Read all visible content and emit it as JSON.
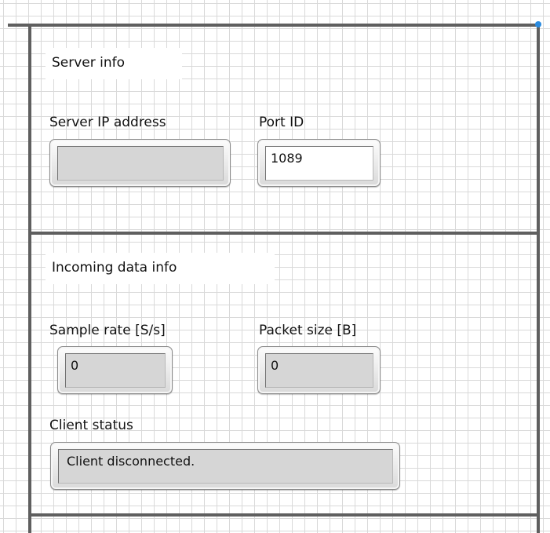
{
  "server_info": {
    "header": "Server info",
    "ip_label": "Server IP address",
    "ip_value": "",
    "port_label": "Port ID",
    "port_value": "1089"
  },
  "incoming_data_info": {
    "header": "Incoming data info",
    "sample_rate_label": "Sample rate [S/s]",
    "sample_rate_value": "0",
    "packet_size_label": "Packet size [B]",
    "packet_size_value": "0"
  },
  "client_status": {
    "label": "Client status",
    "value": "Client disconnected."
  },
  "colors": {
    "accent_dot": "#2a8be0",
    "frame": "#5f5f5f",
    "indicator_fill": "#d6d6d6"
  }
}
